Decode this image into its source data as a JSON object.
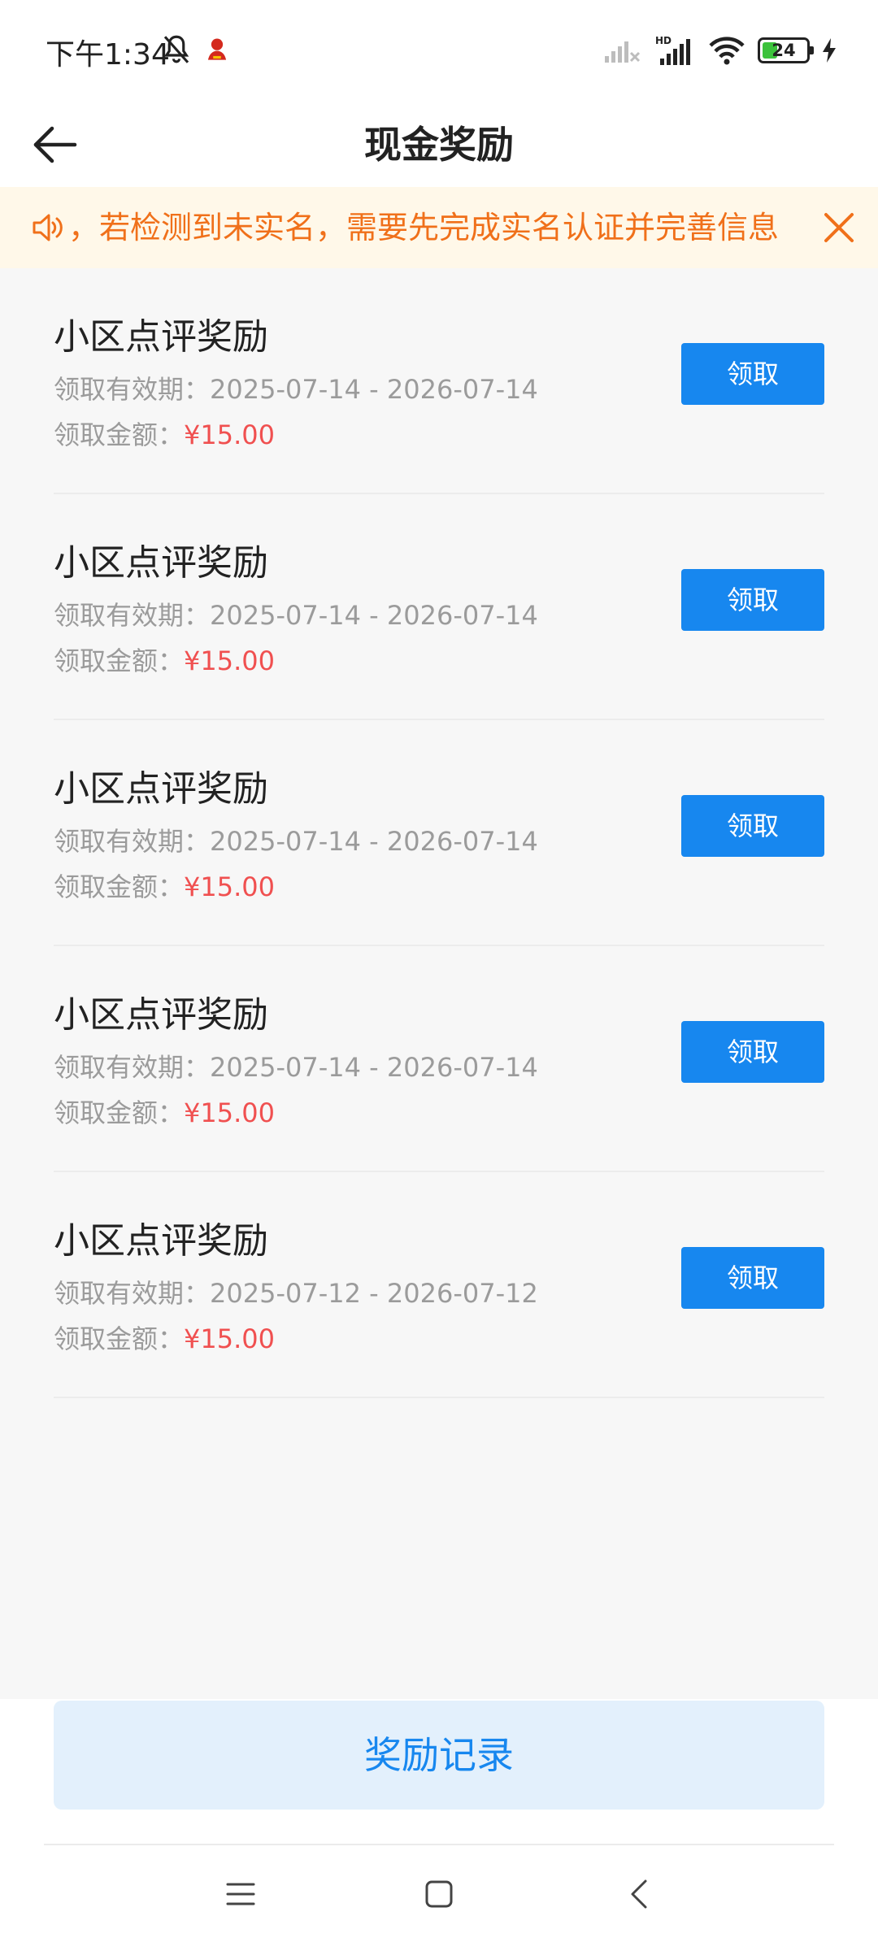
{
  "status_bar": {
    "time": "下午1:34",
    "battery_level": "24",
    "icons": [
      "bell-off-icon",
      "app-notification-icon",
      "signal-weak-icon",
      "hd-signal-icon",
      "wifi-icon",
      "battery-icon",
      "charging-icon"
    ]
  },
  "nav": {
    "title": "现金奖励",
    "back_icon": "arrow-left-icon"
  },
  "notice": {
    "text": "，若检测到未实名，需要先完成实名认证并完善信息",
    "icons": [
      "speaker-icon",
      "close-icon"
    ],
    "color": "#f0701a"
  },
  "rewards": [
    {
      "title": "小区点评奖励",
      "validity_label": "领取有效期：",
      "validity": "2025-07-14 - 2026-07-14",
      "amount_label": "领取金额：",
      "amount": "¥15.00",
      "button": "领取"
    },
    {
      "title": "小区点评奖励",
      "validity_label": "领取有效期：",
      "validity": "2025-07-14 - 2026-07-14",
      "amount_label": "领取金额：",
      "amount": "¥15.00",
      "button": "领取"
    },
    {
      "title": "小区点评奖励",
      "validity_label": "领取有效期：",
      "validity": "2025-07-14 - 2026-07-14",
      "amount_label": "领取金额：",
      "amount": "¥15.00",
      "button": "领取"
    },
    {
      "title": "小区点评奖励",
      "validity_label": "领取有效期：",
      "validity": "2025-07-14 - 2026-07-14",
      "amount_label": "领取金额：",
      "amount": "¥15.00",
      "button": "领取"
    },
    {
      "title": "小区点评奖励",
      "validity_label": "领取有效期：",
      "validity": "2025-07-12 - 2026-07-12",
      "amount_label": "领取金额：",
      "amount": "¥15.00",
      "button": "领取"
    }
  ],
  "records_button": "奖励记录",
  "system_nav": [
    "menu-icon",
    "home-icon",
    "back-icon"
  ],
  "colors": {
    "accent": "#1787ef",
    "amount": "#f05050",
    "notice_bg": "#fff8e9"
  }
}
